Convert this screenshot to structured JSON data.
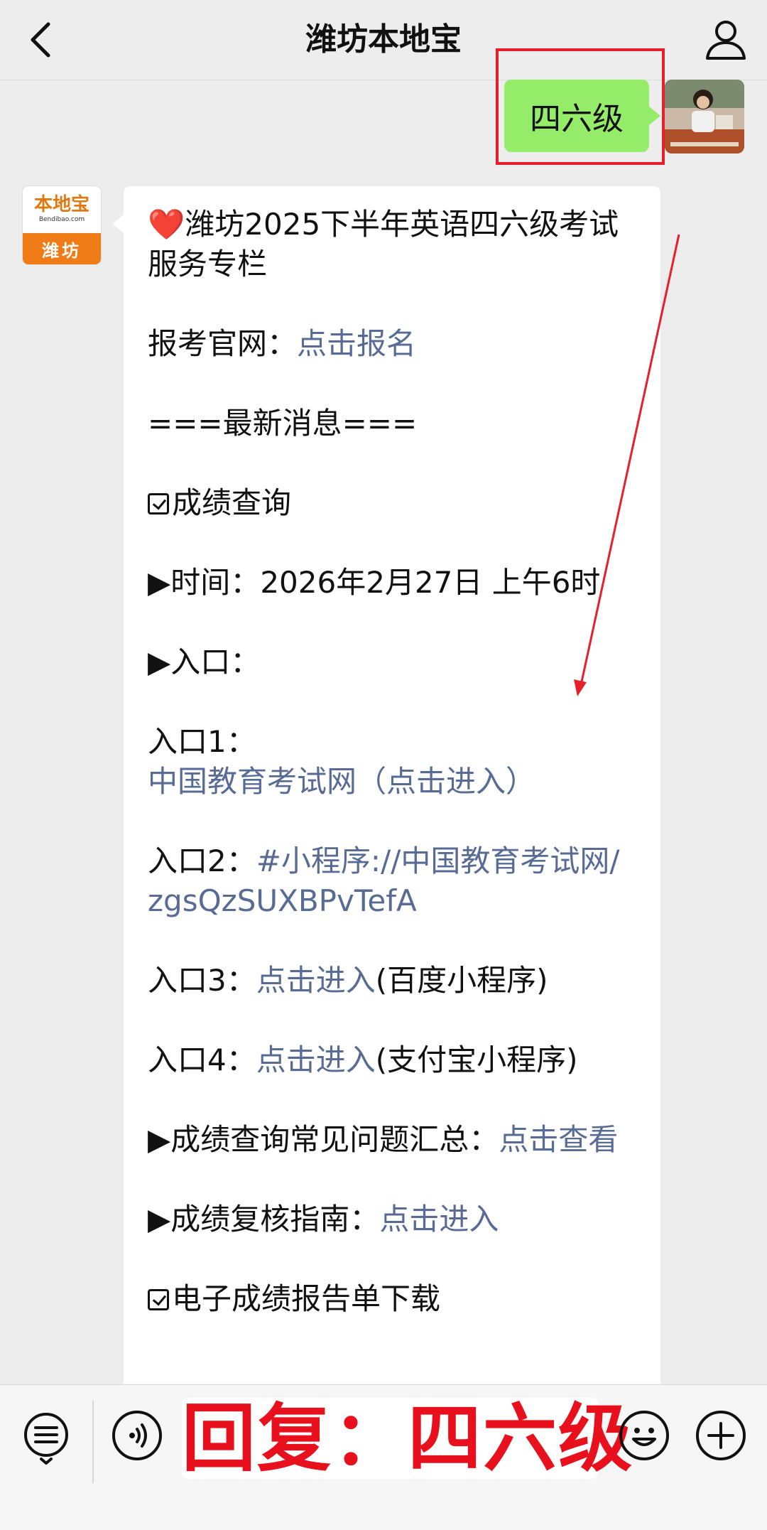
{
  "header": {
    "title": "潍坊本地宝"
  },
  "outgoing": {
    "text": "四六级"
  },
  "bot": {
    "logo_cn": "本地宝",
    "logo_url": "Bendibao.com",
    "logo_city": "潍坊"
  },
  "message": {
    "heart": "❤️",
    "title": "潍坊2025下半年英语四六级考试服务专栏",
    "signup_label": "报考官网：",
    "signup_link": "点击报名",
    "news_heading": "===最新消息===",
    "score_query": "成绩查询",
    "time_label": "▶时间：",
    "time_value": "2026年2月27日 上午6时",
    "entry_heading": "▶入口：",
    "entry1_label": "入口1：",
    "entry1_link": "中国教育考试网（点击进入）",
    "entry2_label": "入口2：",
    "entry2_link": "#小程序://中国教育考试网/zgsQzSUXBPvTefA",
    "entry3_label": "入口3：",
    "entry3_link": "点击进入",
    "entry3_note": "(百度小程序)",
    "entry4_label": "入口4：",
    "entry4_link": "点击进入",
    "entry4_note": "(支付宝小程序)",
    "faq_label": "▶成绩查询常见问题汇总：",
    "faq_link": "点击查看",
    "review_label": "▶成绩复核指南：",
    "review_link": "点击进入",
    "download_text": "电子成绩报告单下载"
  },
  "bottom": {
    "reply_text": "回复：四六级"
  },
  "colors": {
    "bubble_green": "#95ec69",
    "link_blue": "#576b95",
    "annotation_red": "#e6202a"
  },
  "icons": [
    "back-icon",
    "user-icon",
    "menu-list-icon",
    "voice-icon",
    "emoji-icon",
    "plus-icon",
    "heart-icon",
    "checkbox-icon"
  ]
}
